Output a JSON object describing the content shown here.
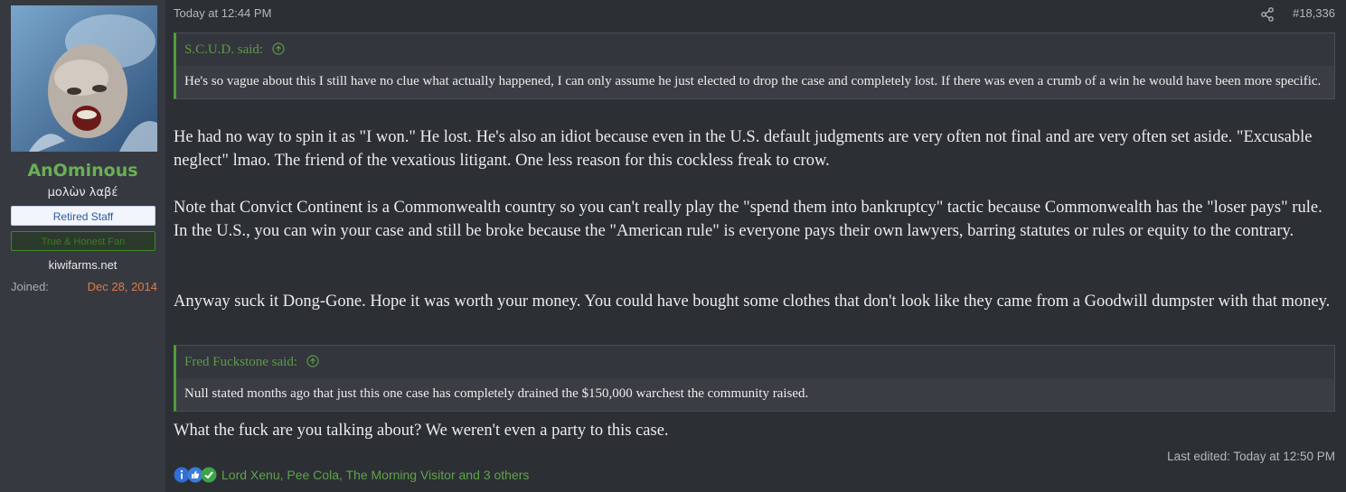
{
  "user": {
    "avatar_icon": "avatar-image",
    "name": "AnOminous",
    "title": "μολὼν λαβέ",
    "banner_staff": "Retired Staff",
    "banner_fan": "True & Honest Fan",
    "site": "kiwifarms.net",
    "joined_label": "Joined:",
    "joined_value": "Dec 28, 2014"
  },
  "post": {
    "timestamp": "Today at 12:44 PM",
    "share_icon": "share-icon",
    "number": "#18,336",
    "quote1": {
      "author": "S.C.U.D. said:",
      "text": "He's so vague about this I still have no clue what actually happened, I can only assume he just elected to drop the case and completely lost. If there was even a crumb of a win he would have been more specific."
    },
    "paragraphs": [
      "He had no way to spin it as \"I won.\" He lost. He's also an idiot because even in the U.S. default judgments are very often not final and are very often set aside. \"Excusable neglect\" lmao. The friend of the vexatious litigant. One less reason for this cockless freak to crow.",
      "Note that Convict Continent is a Commonwealth country so you can't really play the \"spend them into bankruptcy\" tactic because Commonwealth has the \"loser pays\" rule. In the U.S., you can win your case and still be broke because the \"American rule\" is everyone pays their own lawyers, barring statutes or rules or equity to the contrary.",
      "Anyway suck it Dong-Gone. Hope it was worth your money. You could have bought some clothes that don't look like they came from a Goodwill dumpster with that money."
    ],
    "quote2": {
      "author": "Fred Fuckstone said:",
      "text": "Null stated months ago that just this one case has completely drained the $150,000 warchest the community raised."
    },
    "final_paragraph": "What the fuck are you talking about? We weren't even a party to this case.",
    "last_edited": "Last edited: Today at 12:50 PM",
    "reaction_icons": [
      "informative-icon",
      "like-icon",
      "agree-icon"
    ],
    "reaction_users": "Lord Xenu, Pee Cola, The Morning Visitor and 3 others"
  },
  "colors": {
    "accent_green": "#4f9e38",
    "username_green": "#6aaf55",
    "joined_orange": "#e07a4a",
    "background": "#2c2f34",
    "sidebar": "#363a40"
  }
}
